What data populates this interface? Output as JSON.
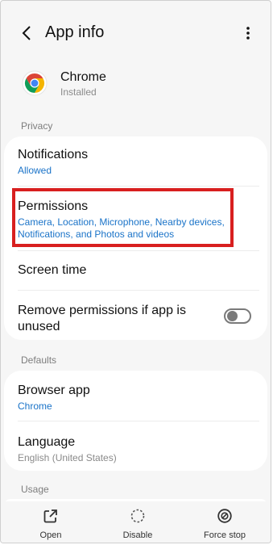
{
  "header": {
    "title": "App info",
    "back_icon": "back-chevron-icon",
    "more_icon": "more-vertical-icon"
  },
  "app": {
    "name": "Chrome",
    "status": "Installed",
    "icon": "chrome-logo-icon"
  },
  "sections": {
    "privacy_label": "Privacy",
    "defaults_label": "Defaults",
    "usage_label": "Usage"
  },
  "privacy": {
    "notifications": {
      "title": "Notifications",
      "value": "Allowed"
    },
    "permissions": {
      "title": "Permissions",
      "value": "Camera, Location, Microphone, Nearby devices, Notifications, and Photos and videos"
    },
    "screen_time": {
      "title": "Screen time"
    },
    "remove_permissions": {
      "title": "Remove permissions if app is unused",
      "enabled": false
    }
  },
  "defaults": {
    "browser_app": {
      "title": "Browser app",
      "value": "Chrome"
    },
    "language": {
      "title": "Language",
      "value": "English (United States)"
    }
  },
  "actions": [
    {
      "label": "Open",
      "icon": "open-external-icon"
    },
    {
      "label": "Disable",
      "icon": "disable-circle-icon"
    },
    {
      "label": "Force stop",
      "icon": "force-stop-icon"
    }
  ],
  "colors": {
    "accent_blue": "#1a73c8",
    "highlight_red": "#d81f1f",
    "background": "#f6f6f6"
  }
}
